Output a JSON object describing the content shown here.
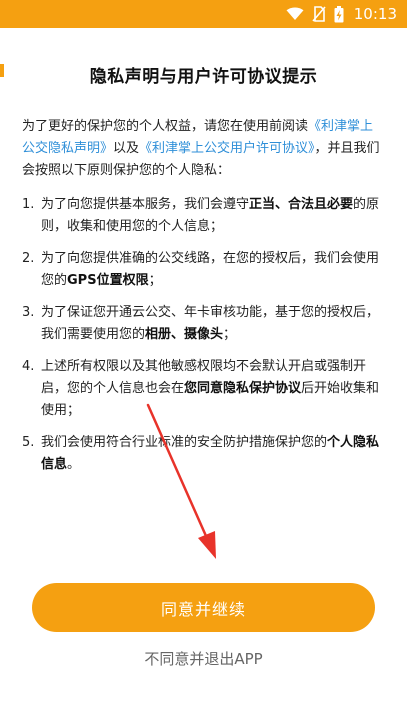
{
  "status_bar": {
    "time": "10:13",
    "icons": [
      "wifi-icon",
      "no-sim-icon",
      "battery-charging-icon"
    ],
    "color": "#f5a011"
  },
  "dialog": {
    "title": "隐私声明与用户许可协议提示",
    "intro": {
      "before": "为了更好的保护您的个人权益，请您在使用前阅读",
      "privacy_link": "《利津掌上公交隐私声明》",
      "middle": "以及",
      "license_link": "《利津掌上公交用户许可协议》",
      "after": "，并且我们会按照以下原则保护您的个人隐私："
    },
    "rules": [
      {
        "num": "1",
        "t1": "为了向您提供基本服务，我们会遵守",
        "b1": "正当、合法且必要",
        "t2": "的原则，收集和使用您的个人信息；"
      },
      {
        "num": "2",
        "t1": "为了向您提供准确的公交线路，在您的授权后，我们会使用您的",
        "b1": "GPS位置权限",
        "t2": "；"
      },
      {
        "num": "3",
        "t1": "为了保证您开通云公交、年卡审核功能，基于您的授权后，我们需要使用您的",
        "b1": "相册、摄像头",
        "t2": "；"
      },
      {
        "num": "4",
        "t1": "上述所有权限以及其他敏感权限均不会默认开启或强制开启，您的个人信息也会在",
        "b1": "您同意隐私保护协议",
        "t2": "后开始收集和使用；"
      },
      {
        "num": "5",
        "t1": "我们会使用符合行业标准的安全防护措施保护您的",
        "b1": "个人隐私信息",
        "t2": "。"
      }
    ],
    "agree_button": "同意并继续",
    "disagree_link": "不同意并退出APP"
  },
  "colors": {
    "accent": "#f5a011",
    "link": "#2f8fd8",
    "annotation_arrow": "#e8332a"
  }
}
